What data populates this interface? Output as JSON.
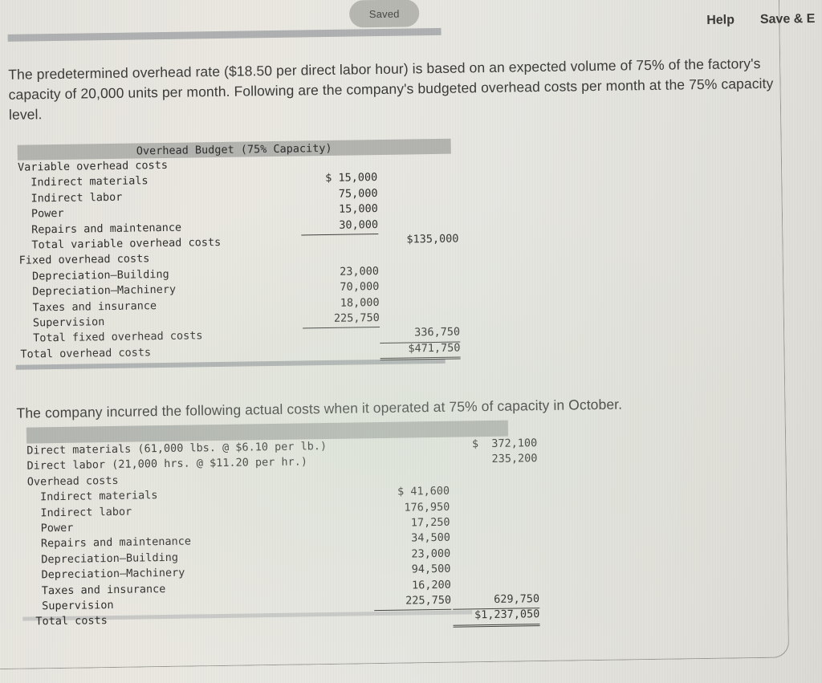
{
  "header": {
    "saved_badge": "Saved",
    "help_label": "Help",
    "save_exit_label": "Save & E"
  },
  "intro_paragraph": "The predetermined overhead rate ($18.50 per direct labor hour) is based on an expected volume of 75% of the factory's capacity of 20,000 units per month. Following are the company's budgeted overhead costs per month at the 75% capacity level.",
  "actual_paragraph": "The company incurred the following actual costs when it operated at 75% of capacity in October.",
  "budget_table": {
    "title": "Overhead Budget (75% Capacity)",
    "rows": [
      {
        "label": "Variable overhead costs",
        "indent": 0,
        "colA": "",
        "colB": ""
      },
      {
        "label": "Indirect materials",
        "indent": 1,
        "colA": "$ 15,000",
        "colB": ""
      },
      {
        "label": "Indirect labor",
        "indent": 1,
        "colA": "75,000",
        "colB": ""
      },
      {
        "label": "Power",
        "indent": 1,
        "colA": "15,000",
        "colB": ""
      },
      {
        "label": "Repairs and maintenance",
        "indent": 1,
        "colA": "30,000",
        "colB": "",
        "colA_rule": "single"
      },
      {
        "label": "Total variable overhead costs",
        "indent": 1,
        "colA": "",
        "colB": "$135,000"
      },
      {
        "label": "Fixed overhead costs",
        "indent": 0,
        "colA": "",
        "colB": ""
      },
      {
        "label": "Depreciation—Building",
        "indent": 1,
        "colA": "23,000",
        "colB": ""
      },
      {
        "label": "Depreciation—Machinery",
        "indent": 1,
        "colA": "70,000",
        "colB": ""
      },
      {
        "label": "Taxes and insurance",
        "indent": 1,
        "colA": "18,000",
        "colB": ""
      },
      {
        "label": "Supervision",
        "indent": 1,
        "colA": "225,750",
        "colB": "",
        "colA_rule": "single"
      },
      {
        "label": "Total fixed overhead costs",
        "indent": 1,
        "colA": "",
        "colB": "336,750",
        "colB_rule": "single"
      },
      {
        "label": "Total overhead costs",
        "indent": 0,
        "colA": "",
        "colB": "$471,750",
        "colB_rule": "double"
      }
    ]
  },
  "actual_table": {
    "title": "",
    "rows": [
      {
        "label": "Direct materials (61,000 lbs. @ $6.10 per lb.)",
        "indent": 0,
        "colA": "",
        "colB": "$  372,100"
      },
      {
        "label": "Direct labor (21,000 hrs. @ $11.20 per hr.)",
        "indent": 0,
        "colA": "",
        "colB": "235,200"
      },
      {
        "label": "Overhead costs",
        "indent": 0,
        "colA": "",
        "colB": ""
      },
      {
        "label": "Indirect materials",
        "indent": 1,
        "colA": "$ 41,600",
        "colB": ""
      },
      {
        "label": "Indirect labor",
        "indent": 1,
        "colA": "176,950",
        "colB": ""
      },
      {
        "label": "Power",
        "indent": 1,
        "colA": "17,250",
        "colB": ""
      },
      {
        "label": "Repairs and maintenance",
        "indent": 1,
        "colA": "34,500",
        "colB": ""
      },
      {
        "label": "Depreciation—Building",
        "indent": 1,
        "colA": "23,000",
        "colB": ""
      },
      {
        "label": "Depreciation—Machinery",
        "indent": 1,
        "colA": "94,500",
        "colB": ""
      },
      {
        "label": "Taxes and insurance",
        "indent": 1,
        "colA": "16,200",
        "colB": ""
      },
      {
        "label": "Supervision",
        "indent": 1,
        "colA": "225,750",
        "colB": "629,750",
        "colA_rule": "single",
        "colB_rule": "single"
      },
      {
        "label": "Total costs",
        "indent": 2,
        "colA": "",
        "colB": "$1,237,050",
        "colB_rule": "double"
      }
    ]
  },
  "colors": {
    "screen_bg": "#e9e8e2",
    "band_gray": "#b5b6b2",
    "rule_gray": "#b0b2b4",
    "pill_gray": "#b9b9b4",
    "text": "#2f2f2d"
  }
}
